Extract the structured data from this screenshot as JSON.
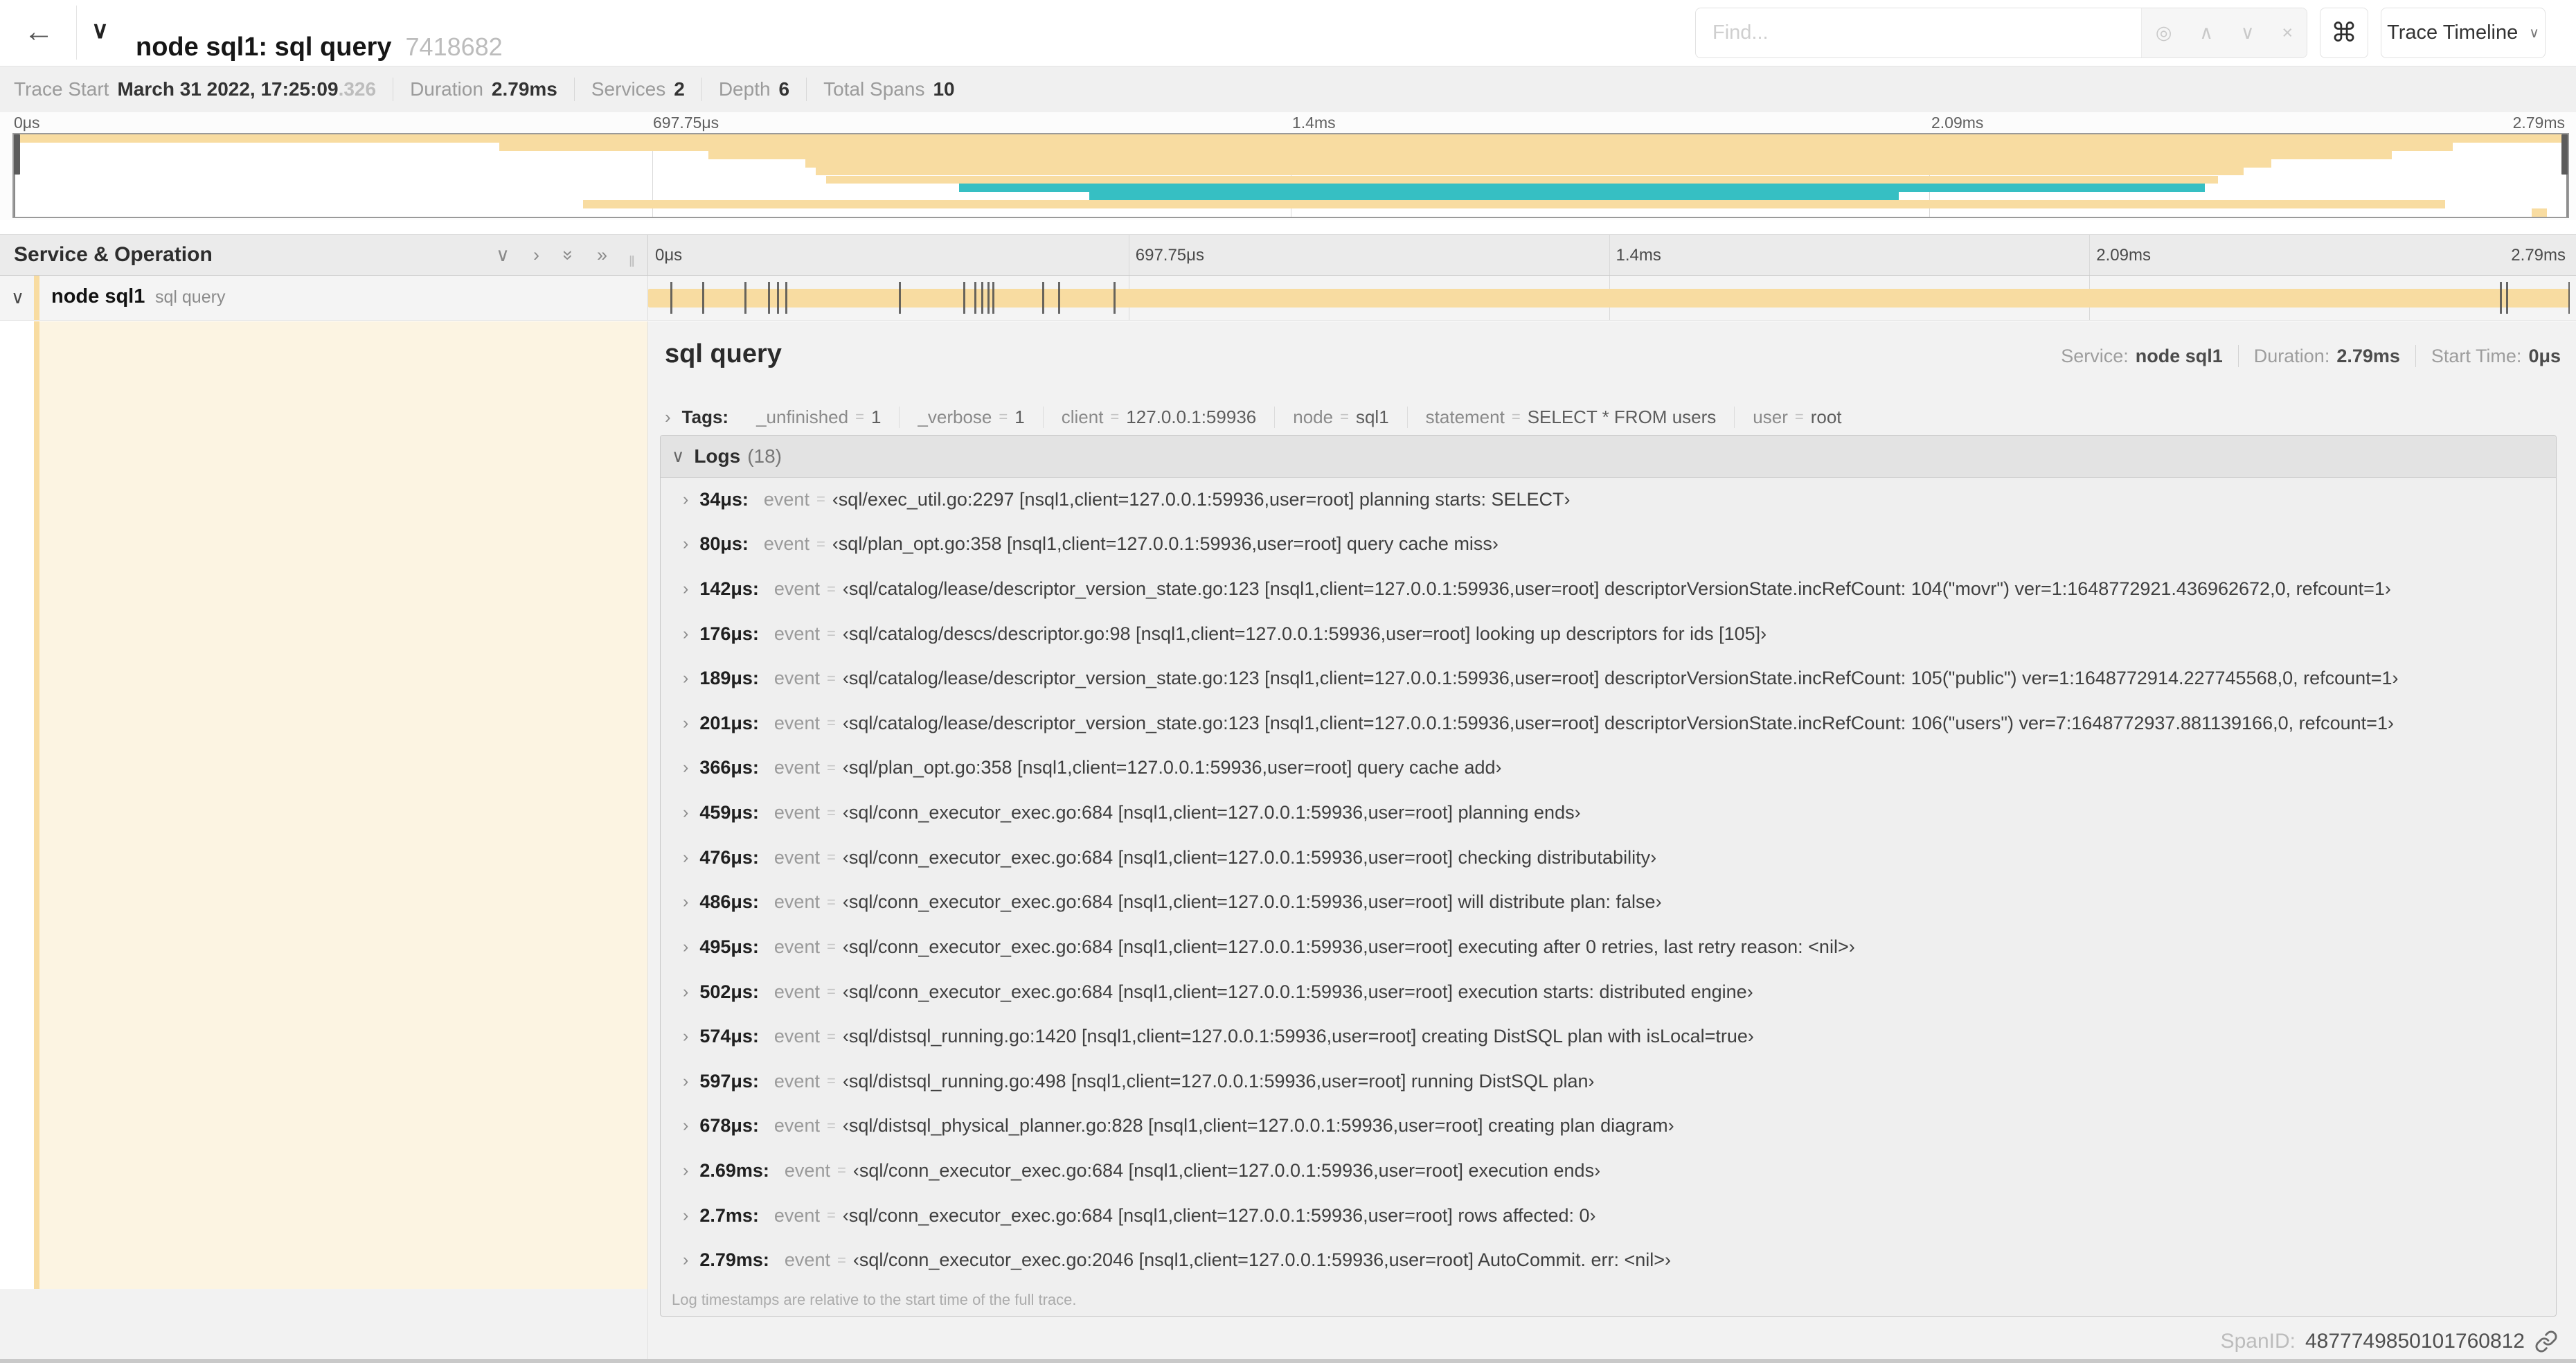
{
  "topbar": {
    "title": "node sql1: sql query",
    "trace_id_short": "7418682",
    "find_placeholder": "Find...",
    "shortcut_label": "⌘",
    "view_selector_label": "Trace Timeline"
  },
  "icons": {
    "back": "←",
    "chevron_down": "∨",
    "chevron_right": "›",
    "double_chevron": "»",
    "find_target": "◎",
    "find_prev": "∧",
    "find_next": "∨",
    "find_clear": "×",
    "column_grip": "‖"
  },
  "stats": [
    {
      "label": "Trace Start",
      "value": "March 31 2022, 17:25:09",
      "suffix": ".326"
    },
    {
      "label": "Duration",
      "value": "2.79ms",
      "suffix": ""
    },
    {
      "label": "Services",
      "value": "2",
      "suffix": ""
    },
    {
      "label": "Depth",
      "value": "6",
      "suffix": ""
    },
    {
      "label": "Total Spans",
      "value": "10",
      "suffix": ""
    }
  ],
  "ruler_ticks": [
    "0μs",
    "697.75μs",
    "1.4ms",
    "2.09ms",
    "2.79ms"
  ],
  "colors": {
    "tan": "#F8DCA1",
    "teal": "#36BFC3",
    "cream": "#FCF4E2"
  },
  "minimap": {
    "spans": [
      {
        "start": 0,
        "end": 100,
        "color": "tan"
      },
      {
        "start": 19,
        "end": 95.5,
        "color": "tan"
      },
      {
        "start": 27.2,
        "end": 93.1,
        "color": "tan"
      },
      {
        "start": 31,
        "end": 88.4,
        "color": "tan"
      },
      {
        "start": 31.4,
        "end": 87.3,
        "color": "tan"
      },
      {
        "start": 31.8,
        "end": 86.3,
        "color": "tan"
      },
      {
        "start": 37,
        "end": 85.8,
        "color": "teal"
      },
      {
        "start": 42.1,
        "end": 73.8,
        "color": "teal"
      },
      {
        "start": 22.3,
        "end": 95.2,
        "color": "tan"
      },
      {
        "start": 98.6,
        "end": 99.2,
        "color": "tan"
      }
    ]
  },
  "tree_header": {
    "title": "Service & Operation"
  },
  "span_row": {
    "service": "node sql1",
    "operation": "sql query",
    "total_us": 2790,
    "log_tick_times_us": [
      34,
      80,
      142,
      176,
      189,
      201,
      366,
      459,
      476,
      486,
      495,
      502,
      574,
      597,
      678,
      2690,
      2700,
      2790
    ]
  },
  "detail": {
    "title": "sql query",
    "meta": [
      {
        "label": "Service:",
        "value": "node sql1"
      },
      {
        "label": "Duration:",
        "value": "2.79ms"
      },
      {
        "label": "Start Time:",
        "value": "0μs"
      }
    ],
    "tags_label": "Tags:",
    "tag_eq": "=",
    "tags": [
      {
        "key": "_unfinished",
        "value": "1"
      },
      {
        "key": "_verbose",
        "value": "1"
      },
      {
        "key": "client",
        "value": "127.0.0.1:59936"
      },
      {
        "key": "node",
        "value": "sql1"
      },
      {
        "key": "statement",
        "value": "SELECT * FROM users"
      },
      {
        "key": "user",
        "value": "root"
      }
    ],
    "logs_label": "Logs",
    "logs_count": "(18)",
    "log_key": "event",
    "log_eq": "=",
    "logs": [
      {
        "time": "34μs:",
        "value": "‹sql/exec_util.go:2297 [nsql1,client=127.0.0.1:59936,user=root] planning starts: SELECT›"
      },
      {
        "time": "80μs:",
        "value": "‹sql/plan_opt.go:358 [nsql1,client=127.0.0.1:59936,user=root] query cache miss›"
      },
      {
        "time": "142μs:",
        "value": "‹sql/catalog/lease/descriptor_version_state.go:123 [nsql1,client=127.0.0.1:59936,user=root] descriptorVersionState.incRefCount: 104(\"movr\") ver=1:1648772921.436962672,0, refcount=1›"
      },
      {
        "time": "176μs:",
        "value": "‹sql/catalog/descs/descriptor.go:98 [nsql1,client=127.0.0.1:59936,user=root] looking up descriptors for ids [105]›"
      },
      {
        "time": "189μs:",
        "value": "‹sql/catalog/lease/descriptor_version_state.go:123 [nsql1,client=127.0.0.1:59936,user=root] descriptorVersionState.incRefCount: 105(\"public\") ver=1:1648772914.227745568,0, refcount=1›"
      },
      {
        "time": "201μs:",
        "value": "‹sql/catalog/lease/descriptor_version_state.go:123 [nsql1,client=127.0.0.1:59936,user=root] descriptorVersionState.incRefCount: 106(\"users\") ver=7:1648772937.881139166,0, refcount=1›"
      },
      {
        "time": "366μs:",
        "value": "‹sql/plan_opt.go:358 [nsql1,client=127.0.0.1:59936,user=root] query cache add›"
      },
      {
        "time": "459μs:",
        "value": "‹sql/conn_executor_exec.go:684 [nsql1,client=127.0.0.1:59936,user=root] planning ends›"
      },
      {
        "time": "476μs:",
        "value": "‹sql/conn_executor_exec.go:684 [nsql1,client=127.0.0.1:59936,user=root] checking distributability›"
      },
      {
        "time": "486μs:",
        "value": "‹sql/conn_executor_exec.go:684 [nsql1,client=127.0.0.1:59936,user=root] will distribute plan: false›"
      },
      {
        "time": "495μs:",
        "value": "‹sql/conn_executor_exec.go:684 [nsql1,client=127.0.0.1:59936,user=root] executing after 0 retries, last retry reason: <nil>›"
      },
      {
        "time": "502μs:",
        "value": "‹sql/conn_executor_exec.go:684 [nsql1,client=127.0.0.1:59936,user=root] execution starts: distributed engine›"
      },
      {
        "time": "574μs:",
        "value": "‹sql/distsql_running.go:1420 [nsql1,client=127.0.0.1:59936,user=root] creating DistSQL plan with isLocal=true›"
      },
      {
        "time": "597μs:",
        "value": "‹sql/distsql_running.go:498 [nsql1,client=127.0.0.1:59936,user=root] running DistSQL plan›"
      },
      {
        "time": "678μs:",
        "value": "‹sql/distsql_physical_planner.go:828 [nsql1,client=127.0.0.1:59936,user=root] creating plan diagram›"
      },
      {
        "time": "2.69ms:",
        "value": "‹sql/conn_executor_exec.go:684 [nsql1,client=127.0.0.1:59936,user=root] execution ends›"
      },
      {
        "time": "2.7ms:",
        "value": "‹sql/conn_executor_exec.go:684 [nsql1,client=127.0.0.1:59936,user=root] rows affected: 0›"
      },
      {
        "time": "2.79ms:",
        "value": "‹sql/conn_executor_exec.go:2046 [nsql1,client=127.0.0.1:59936,user=root] AutoCommit. err: <nil>›"
      }
    ],
    "footer_note": "Log timestamps are relative to the start time of the full trace.",
    "span_id_label": "SpanID:",
    "span_id": "4877749850101760812"
  }
}
